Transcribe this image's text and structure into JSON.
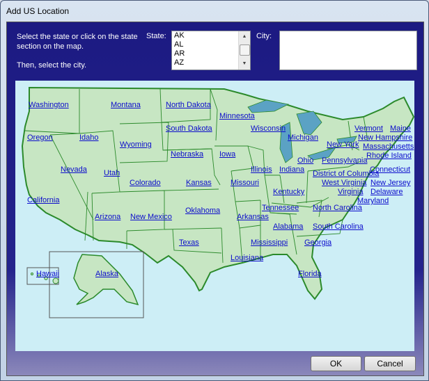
{
  "window": {
    "title": "Add US Location"
  },
  "instructions": {
    "line1": "Select the state or click on the state",
    "line2": "section on the map.",
    "line3": "Then, select the city."
  },
  "state_field": {
    "label": "State:",
    "options": [
      "AK",
      "AL",
      "AR",
      "AZ"
    ]
  },
  "city_field": {
    "label": "City:",
    "value": ""
  },
  "map": {
    "states": {
      "washington": "Washington",
      "montana": "Montana",
      "north_dakota": "North Dakota",
      "minnesota": "Minnesota",
      "south_dakota": "South Dakota",
      "wisconsin": "Wisconsin",
      "vermont": "Vermont",
      "maine": "Maine",
      "new_hampshire": "New Hampshire",
      "oregon": "Oregon",
      "idaho": "Idaho",
      "wyoming": "Wyoming",
      "michigan": "Michigan",
      "new_york": "New York",
      "massachusetts": "Massachusetts",
      "rhode_island": "Rhode Island",
      "nebraska": "Nebraska",
      "iowa": "Iowa",
      "ohio": "Ohio",
      "pennsylvania": "Pennsylvania",
      "nevada": "Nevada",
      "illinois": "Illinois",
      "indiana": "Indiana",
      "district_of_columbia": "District of Columbia",
      "connecticut": "Connecticut",
      "utah": "Utah",
      "colorado": "Colorado",
      "kansas": "Kansas",
      "missouri": "Missouri",
      "west_virginia": "West Virginia",
      "new_jersey": "New Jersey",
      "california": "California",
      "kentucky": "Kentucky",
      "virginia": "Virginia",
      "delaware": "Delaware",
      "maryland": "Maryland",
      "tennessee": "Tennessee",
      "north_carolina": "North Carolina",
      "arizona": "Arizona",
      "new_mexico": "New Mexico",
      "oklahoma": "Oklahoma",
      "arkansas": "Arkansas",
      "alabama": "Alabama",
      "south_carolina": "South Carolina",
      "texas": "Texas",
      "mississippi": "Mississippi",
      "georgia": "Georgia",
      "louisiana": "Louisiana",
      "hawaii": "Hawaii",
      "alaska": "Alaska",
      "florida": "Florida"
    }
  },
  "buttons": {
    "ok": "OK",
    "cancel": "Cancel"
  },
  "colors": {
    "map_water": "#cdeef6",
    "state_fill": "#c7e6c3",
    "state_border": "#2b8a2b",
    "link": "#0b0bcc",
    "lake": "#5ba2c4"
  }
}
